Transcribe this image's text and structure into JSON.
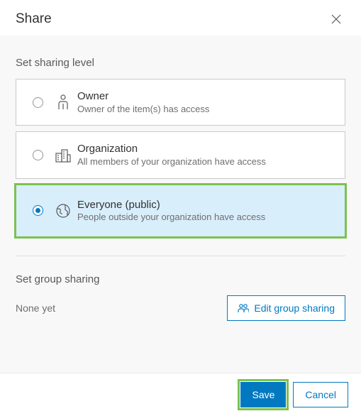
{
  "dialog": {
    "title": "Share"
  },
  "sharing": {
    "section_title": "Set sharing level",
    "options": [
      {
        "title": "Owner",
        "description": "Owner of the item(s) has access",
        "icon": "owner-icon",
        "selected": false
      },
      {
        "title": "Organization",
        "description": "All members of your organization have access",
        "icon": "organization-icon",
        "selected": false
      },
      {
        "title": "Everyone (public)",
        "description": "People outside your organization have access",
        "icon": "globe-icon",
        "selected": true
      }
    ]
  },
  "group_sharing": {
    "section_title": "Set group sharing",
    "status_text": "None yet",
    "edit_label": "Edit group sharing"
  },
  "footer": {
    "save_label": "Save",
    "cancel_label": "Cancel"
  }
}
